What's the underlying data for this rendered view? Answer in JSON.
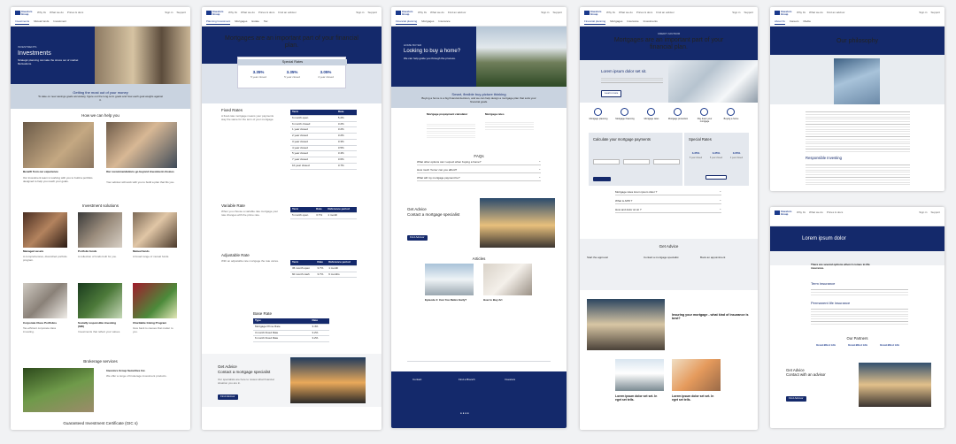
{
  "nav": {
    "logo": "Investors Group",
    "links": [
      "Why IG",
      "What we do",
      "Prices & docs",
      "Find an advisor"
    ],
    "right": [
      "Sign in",
      "Support",
      "FR"
    ]
  },
  "sub1": [
    "Investments",
    "Mutual funds",
    "Investment"
  ],
  "sub2": [
    "Planning Investment",
    "Mortgages",
    "Estate",
    "Tax"
  ],
  "sub3": [
    "Financial planning",
    "Mortgages",
    "Insurance",
    "Investments"
  ],
  "sub4": [
    "Financial planning",
    "Mortgages",
    "Insurance",
    "Investments",
    "Banking"
  ],
  "sub5": [
    "About IG",
    "Careers",
    "Media",
    "Contact"
  ],
  "p1": {
    "eyebrow": "INVESTMENTS",
    "title": "Investments",
    "intro": "Strategic planning can take the stress out of market fluctuations.",
    "band_title": "Getting the most out of your money",
    "band_text": "To take on new savings goals accurately, figure out the long-term goals and how each goal weighs against it.",
    "help_title": "How we can help you",
    "b1_title": "Benefit from our experience",
    "b1_text": "Our investment team is working with you to build a portfolio designed to help you reach your goals.",
    "b2_title": "Our recommendations go beyond investment choices",
    "b2_text": "Your advisor will work with you to build a plan that fits you.",
    "sol_title": "Investment solutions",
    "sols": [
      {
        "t": "Managed assets",
        "d": "A comprehensive, diversified portfolio program."
      },
      {
        "t": "Portfolio funds",
        "d": "A collection of funds built for you."
      },
      {
        "t": "Mutual funds",
        "d": "A broad range of mutual funds."
      },
      {
        "t": "Corporate Class Portfolios",
        "d": "Tax-efficient corporate class investing."
      },
      {
        "t": "Socially responsible investing (SRI)",
        "d": "Investments that reflect your values."
      },
      {
        "t": "Charitable Giving Program",
        "d": "Give back to causes that matter to you."
      }
    ],
    "learn": "Learn more >",
    "brok_title": "Brokerage services",
    "brok_item": "Investors Group Securities Inc.",
    "brok_text": "We offer a range of brokerage investment products.",
    "gic_title": "Guaranteed Investment Certificate (GIC s)"
  },
  "p2": {
    "title": "Mortgages are an important part of your financial plan.",
    "rates_title": "Special Rates",
    "rates": [
      {
        "r": "3.35%",
        "l": "5 year closed"
      },
      {
        "r": "3.35%",
        "l": "5 year closed"
      },
      {
        "r": "3.05%",
        "l": "4 year closed"
      }
    ],
    "fixed_title": "Fixed Rates",
    "fixed_text": "A fixed-rate mortgage means your payments stay the same for the term of your mortgage.",
    "fixed_head": [
      "Term",
      "Rate"
    ],
    "fixed_rows": [
      [
        "6 month open",
        "5.2%"
      ],
      [
        "6 month closed",
        "3.2%"
      ],
      [
        "1 year closed",
        "3.2%"
      ],
      [
        "2 year closed",
        "3.2%"
      ],
      [
        "3 year closed",
        "3.3%"
      ],
      [
        "4 year closed",
        "3.5%"
      ],
      [
        "5 year closed",
        "3.4%"
      ],
      [
        "7 year closed",
        "3.6%"
      ],
      [
        "10 year closed",
        "3.7%"
      ]
    ],
    "var_title": "Variable Rate",
    "var_text": "When you choose a variable rate mortgage your rate changes with the prime rate.",
    "var_head": [
      "Term",
      "Rate",
      "Reference period"
    ],
    "var_rows": [
      [
        "5 month open",
        "3.7%",
        "1 month"
      ]
    ],
    "adj_title": "Adjustable Rate",
    "adj_text": "With an adjustable rate mortgage the rate varies.",
    "adj_head": [
      "Term",
      "Rate",
      "Reference period"
    ],
    "adj_rows": [
      [
        "36 month open",
        "3.7%",
        "1 month"
      ],
      [
        "60 month cash",
        "3.7%",
        "6 months"
      ]
    ],
    "base_title": "Base Rate",
    "base_head": [
      "Type",
      "Rate"
    ],
    "base_rows": [
      [
        "Mortgage Prime Rate",
        "3.4%"
      ],
      [
        "3 month Fixed Rate",
        "3.2%"
      ],
      [
        "6 month Fixed Rate",
        "3.2%"
      ]
    ],
    "advice_title": "Get Advice\nContact a mortgage specialist",
    "advice_text": "Our specialists are here to review what financial situation you are in.",
    "advice_btn": "Find Advisor"
  },
  "p3": {
    "eyebrow": "HOME BUYER",
    "title": "Looking to buy a home?",
    "sub": "We can help guide you through the process.",
    "band_title": "Smart, flexible buy-picture thinking",
    "band_text": "Buying a home is a big financial decision, and we can help design a mortgage plan that suits your financial goals.",
    "calc1": "Mortgage prepayment calculator",
    "calc2": "Mortgage rates",
    "faq_title": "FAQs",
    "faqs": [
      "What other options can I expect when buying a home?",
      "How much 'home' can you afford?",
      "What will my mortgage payment be?"
    ],
    "adv_title": "Get Advice\nContact a mortgage specialist",
    "adv_btn": "Find Advisor",
    "art_title": "Articles",
    "art1_title": "Episode 4: Can You Retire Early?",
    "art2_title": "How to Buy Art",
    "footer_cols": [
      "Contact",
      "Find a Branch",
      "Investors"
    ]
  },
  "p4": {
    "eyebrow": "CREDIT ADVISOR",
    "title": "Mortgages are an important part of your financial plan.",
    "lorem": "Lorem ipsum dolor set sit.",
    "icons": [
      "Mortgage planning",
      "Mortgage financing",
      "Mortgage rates",
      "Mortgage protection",
      "Pay down your mortgage",
      "Buying a home"
    ],
    "calc_title": "Calculate your mortgage payments",
    "rates_title": "Special Rates",
    "rates": [
      {
        "r": "3.35%",
        "l": "5 year closed"
      },
      {
        "r": "3.35%",
        "l": "5 year closed"
      },
      {
        "r": "3.05%",
        "l": "4 year closed"
      }
    ],
    "faqs": [
      "Mortgage rates lorem ipsum dolor ?",
      "What is APR ?",
      "How and dolor sit sit ?"
    ],
    "advice_title": "Get Advice",
    "adv_cols": [
      "Start the approval",
      "Contact a mortgage specialist",
      "Book an appointment"
    ],
    "insure_title": "Insuring your mortgage - what kind of insurance is best?",
    "art1": "Lorem ipsum dolor set set. In eget set tells.",
    "art2": "Lorem ipsum dolor set set. In eget set tells."
  },
  "p5": {
    "title": "Our philosophy",
    "resp": "Responsible Investing"
  },
  "p6": {
    "title": "Lorem ipsum dolor",
    "q": "There are several options when it comes to life insurance.",
    "term": "Term insurance",
    "perm": "Permanent life insurance",
    "partners": "Our Partners",
    "partner_names": [
      "Great-West Life",
      "Great-West Life",
      "Great-West Life"
    ],
    "adv_title": "Get Advice\nContact with an advisor",
    "adv_btn": "Find Advisor"
  }
}
